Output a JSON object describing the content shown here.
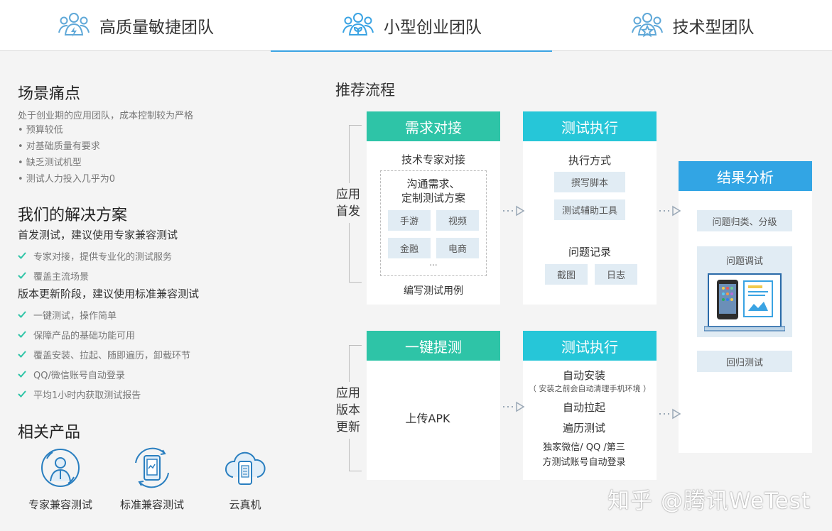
{
  "tabs": [
    {
      "label": "高质量敏捷团队",
      "icon": "team-lightning-icon",
      "active": false
    },
    {
      "label": "小型创业团队",
      "icon": "team-sprout-icon",
      "active": true
    },
    {
      "label": "技术型团队",
      "icon": "team-star-icon",
      "active": false
    }
  ],
  "pain": {
    "title": "场景痛点",
    "intro": "处于创业期的应用团队，成本控制较为严格",
    "bullets": [
      "• 预算较低",
      "• 对基础质量有要求",
      "• 缺乏测试机型",
      "• 测试人力投入几乎为0"
    ]
  },
  "solution": {
    "title": "我们的解决方案",
    "first_title": "首发测试，建议使用专家兼容测试",
    "first_items": [
      "专家对接，提供专业化的测试服务",
      "覆盖主流场景"
    ],
    "update_title": "版本更新阶段，建议使用标准兼容测试",
    "update_items": [
      "一键测试，操作简单",
      "保障产品的基础功能可用",
      "覆盖安装、拉起、随即遍历，卸载环节",
      "QQ/微信账号自动登录",
      "平均1小时内获取测试报告"
    ]
  },
  "products": {
    "title": "相关产品",
    "items": [
      {
        "name": "专家兼容测试",
        "icon": "expert-person-icon"
      },
      {
        "name": "标准兼容测试",
        "icon": "phone-refresh-icon"
      },
      {
        "name": "云真机",
        "icon": "cloud-phone-icon"
      }
    ]
  },
  "flow": {
    "title": "推荐流程",
    "row1_label": [
      "应用",
      "首发"
    ],
    "row2_label": [
      "应用",
      "版本",
      "更新"
    ],
    "demand": {
      "head": "需求对接",
      "sub": "技术专家对接",
      "box_title": [
        "沟通需求、",
        "定制测试方案"
      ],
      "tags": [
        "手游",
        "视频",
        "金融",
        "电商"
      ],
      "ellipsis": "...",
      "footer": "编写测试用例"
    },
    "exec1": {
      "head": "测试执行",
      "method_title": "执行方式",
      "methods": [
        "撰写脚本",
        "测试辅助工具"
      ],
      "record_title": "问题记录",
      "records": [
        "截图",
        "日志"
      ]
    },
    "onekey": {
      "head": "一键提测",
      "upload": "上传APK"
    },
    "exec2": {
      "head": "测试执行",
      "install": "自动安装",
      "install_note": "（ 安装之前会自动清理手机环境 ）",
      "launch": "自动拉起",
      "traverse": "遍历测试",
      "login_lines": [
        "独家微信/ QQ /第三",
        "方测试账号自动登录"
      ]
    },
    "result": {
      "head": "结果分析",
      "classify": "问题归类、分级",
      "debug": "问题调试",
      "regress": "回归测试"
    }
  },
  "watermark": "知乎 @腾讯WeTest",
  "colors": {
    "green": "#2ec4a7",
    "cyan": "#26c6d8",
    "blue": "#32a5e4",
    "check": "#2ec4a7",
    "active_tab": "#3aa3e3"
  }
}
